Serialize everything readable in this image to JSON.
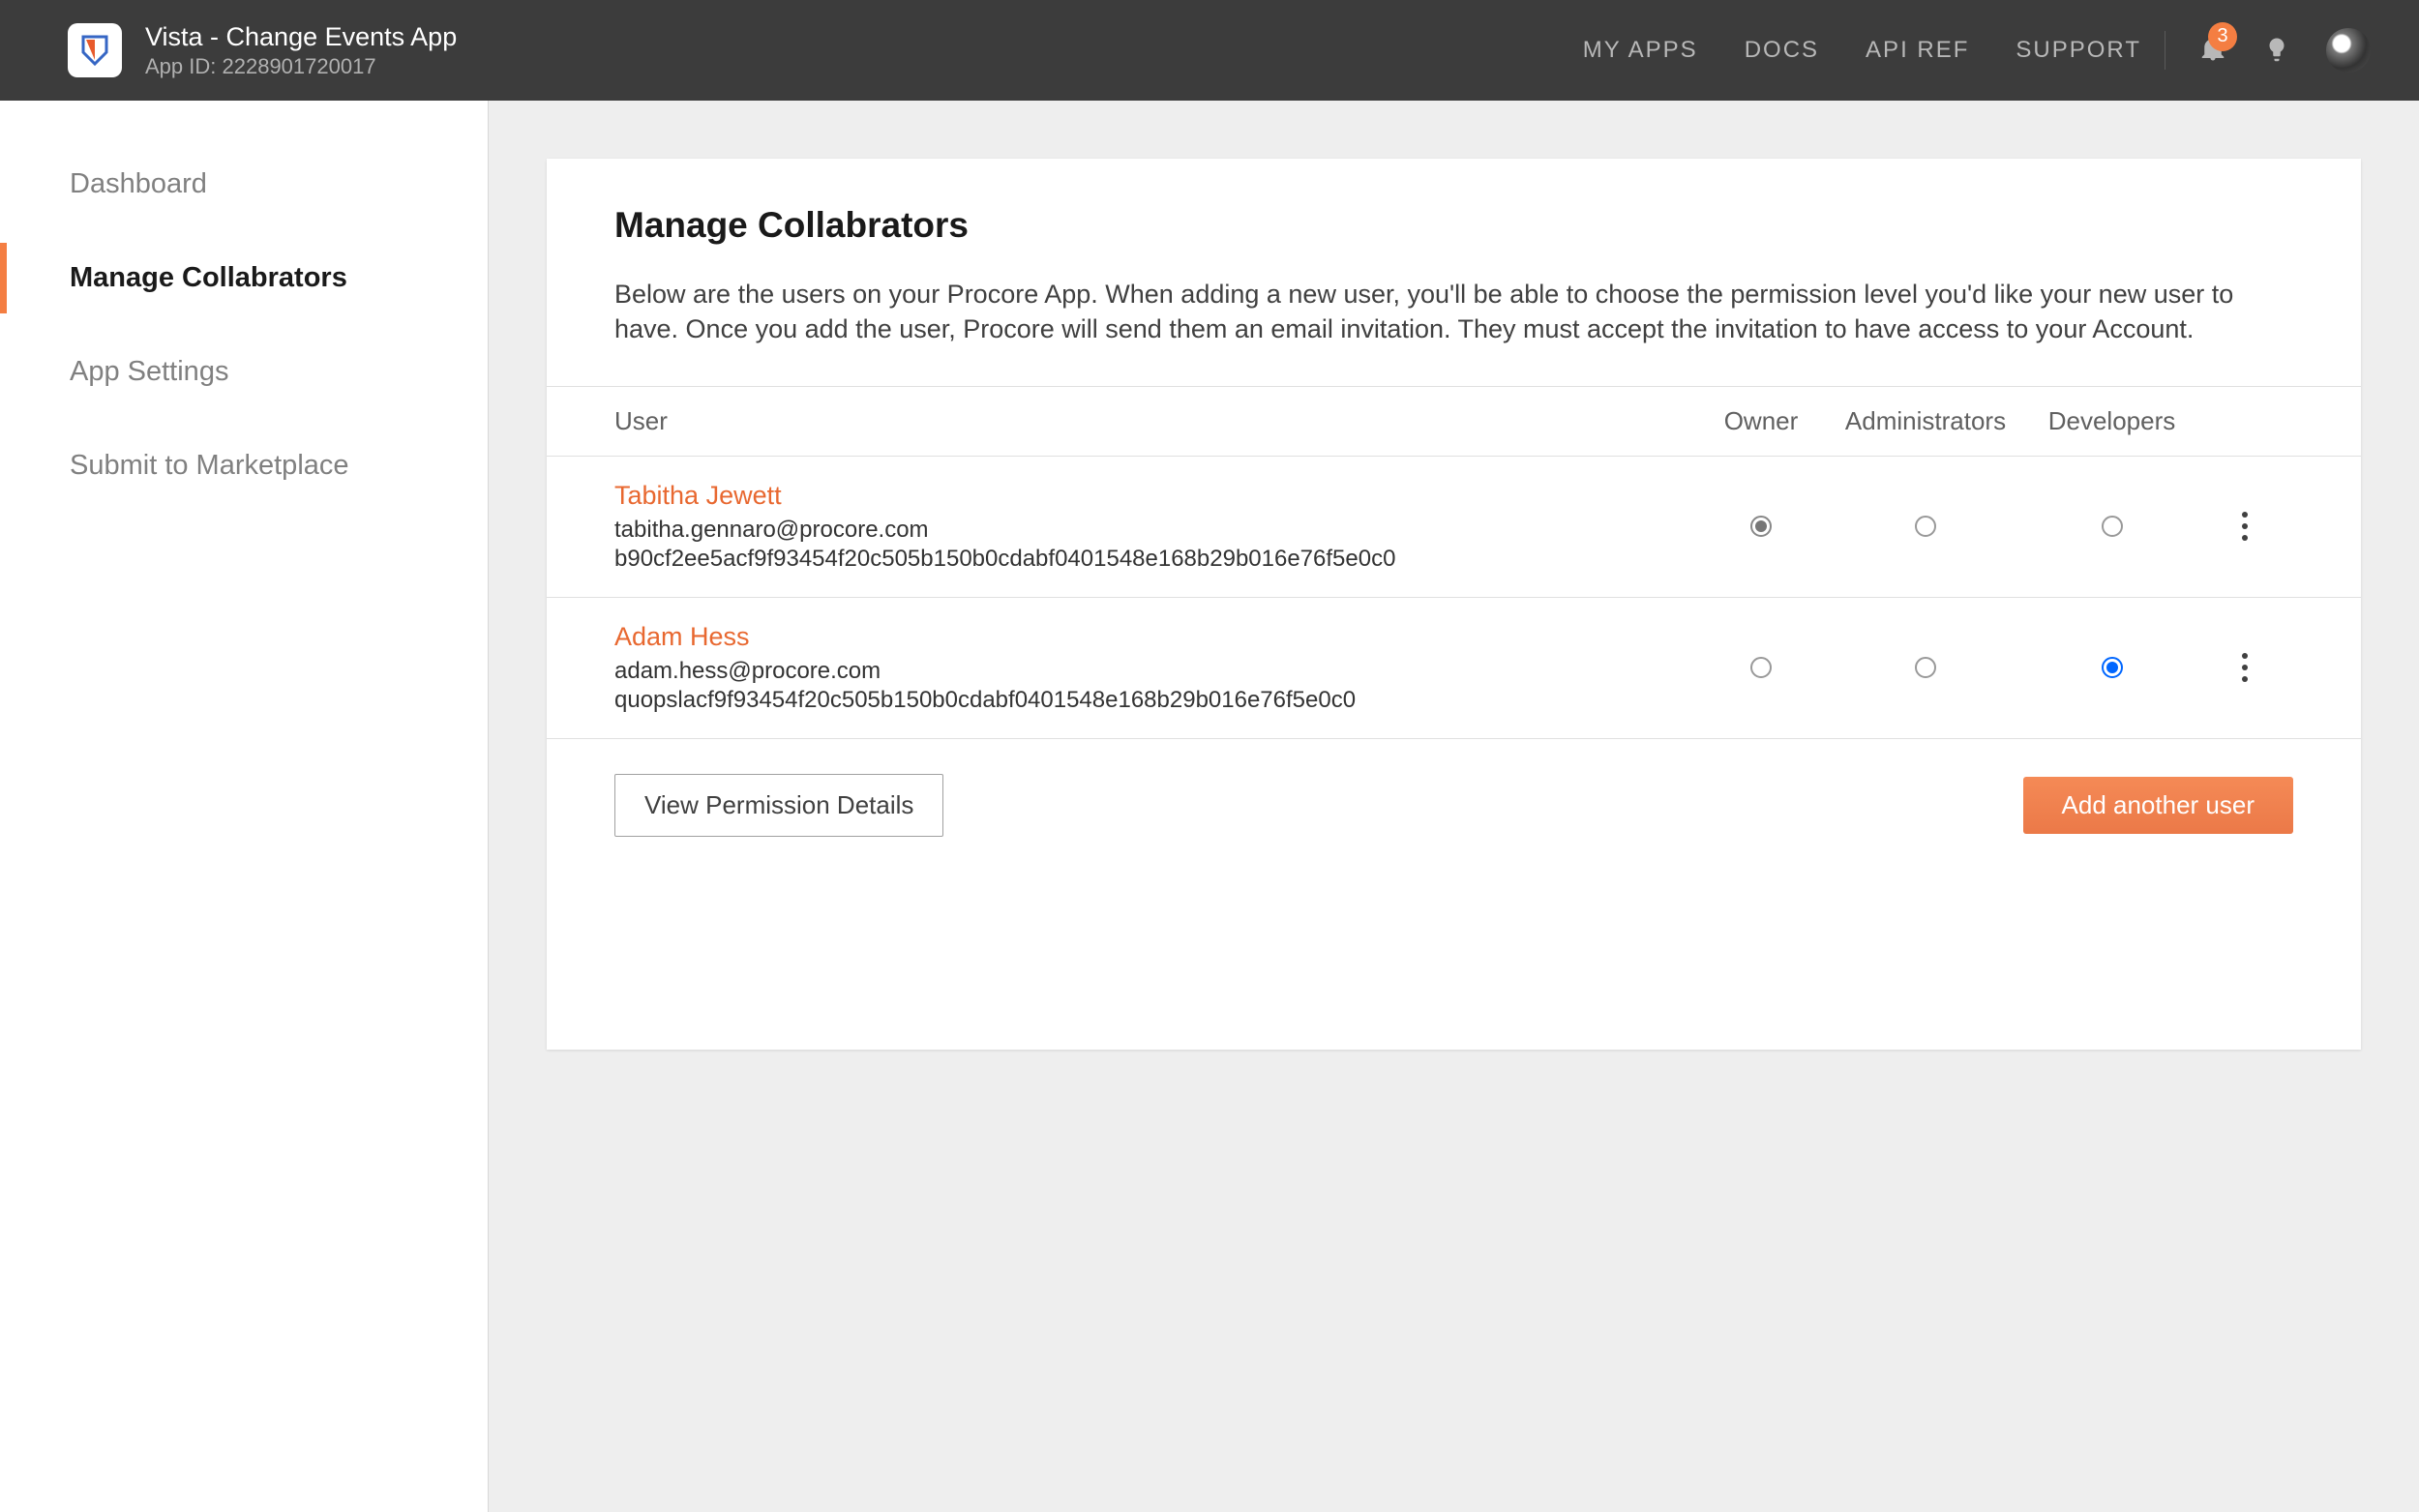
{
  "header": {
    "appTitle": "Vista - Change Events App",
    "appIdLabel": "App ID:",
    "appId": "2228901720017",
    "notificationCount": "3",
    "nav": {
      "myApps": "MY APPS",
      "docs": "DOCS",
      "apiRef": "API REF",
      "support": "SUPPORT"
    }
  },
  "sidebar": {
    "items": [
      {
        "label": "Dashboard"
      },
      {
        "label": "Manage Collabrators"
      },
      {
        "label": "App Settings"
      },
      {
        "label": "Submit to Marketplace"
      }
    ]
  },
  "main": {
    "title": "Manage Collabrators",
    "description": "Below are the users on your Procore App. When adding a new user, you'll be able to choose the permission level you'd like your new user to have. Once you add the user, Procore will send them an email invitation. They must accept the invitation to have access to your Account.",
    "columns": {
      "user": "User",
      "owner": "Owner",
      "admin": "Administrators",
      "dev": "Developers"
    },
    "users": [
      {
        "name": "Tabitha Jewett",
        "email": "tabitha.gennaro@procore.com",
        "token": "b90cf2ee5acf9f93454f20c505b150b0cdabf0401548e168b29b016e76f5e0c0",
        "role": "owner"
      },
      {
        "name": "Adam Hess",
        "email": "adam.hess@procore.com",
        "token": "quopslacf9f93454f20c505b150b0cdabf0401548e168b29b016e76f5e0c0",
        "role": "dev"
      }
    ],
    "buttons": {
      "viewPermission": "View Permission Details",
      "addUser": "Add another user"
    }
  }
}
